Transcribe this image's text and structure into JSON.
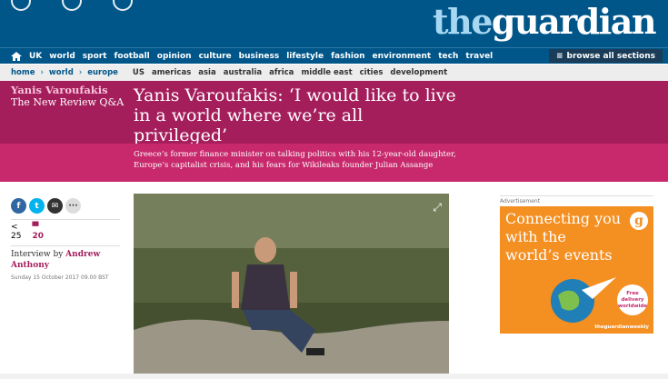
{
  "masthead": {
    "logo_the": "the",
    "logo_guardian": "guardian"
  },
  "nav": {
    "items": [
      "UK",
      "world",
      "sport",
      "football",
      "opinion",
      "culture",
      "business",
      "lifestyle",
      "fashion",
      "environment",
      "tech",
      "travel"
    ],
    "browse_label": "browse all sections"
  },
  "subnav": {
    "breadcrumb": [
      "home",
      "world",
      "europe"
    ],
    "regions": [
      "US",
      "americas",
      "asia",
      "australia",
      "africa",
      "middle east",
      "cities",
      "development"
    ]
  },
  "article": {
    "series_title": "Yanis Varoufakis",
    "series_sub": "The New Review Q&A",
    "headline": "Yanis Varoufakis: ‘I would like to live in a world where we’re all privileged’",
    "standfirst": "Greece’s former finance minister on talking politics with his 12-year-old daughter, Europe’s capitalist crisis, and his fears for Wikileaks founder Julian Assange",
    "share_count": "25",
    "comment_count": "20",
    "byline_prefix": "Interview by ",
    "author": "Andrew Anthony",
    "date": "Sunday 15 October 2017 09.00 BST"
  },
  "ad": {
    "label": "Advertisement",
    "headline": "Connecting you with the world’s events",
    "badge": "Free delivery worldwide",
    "brand": "theguardianweekly"
  },
  "colors": {
    "brand_blue": "#005689",
    "accent": "#a51e5c",
    "ad_orange": "#f48f22"
  }
}
